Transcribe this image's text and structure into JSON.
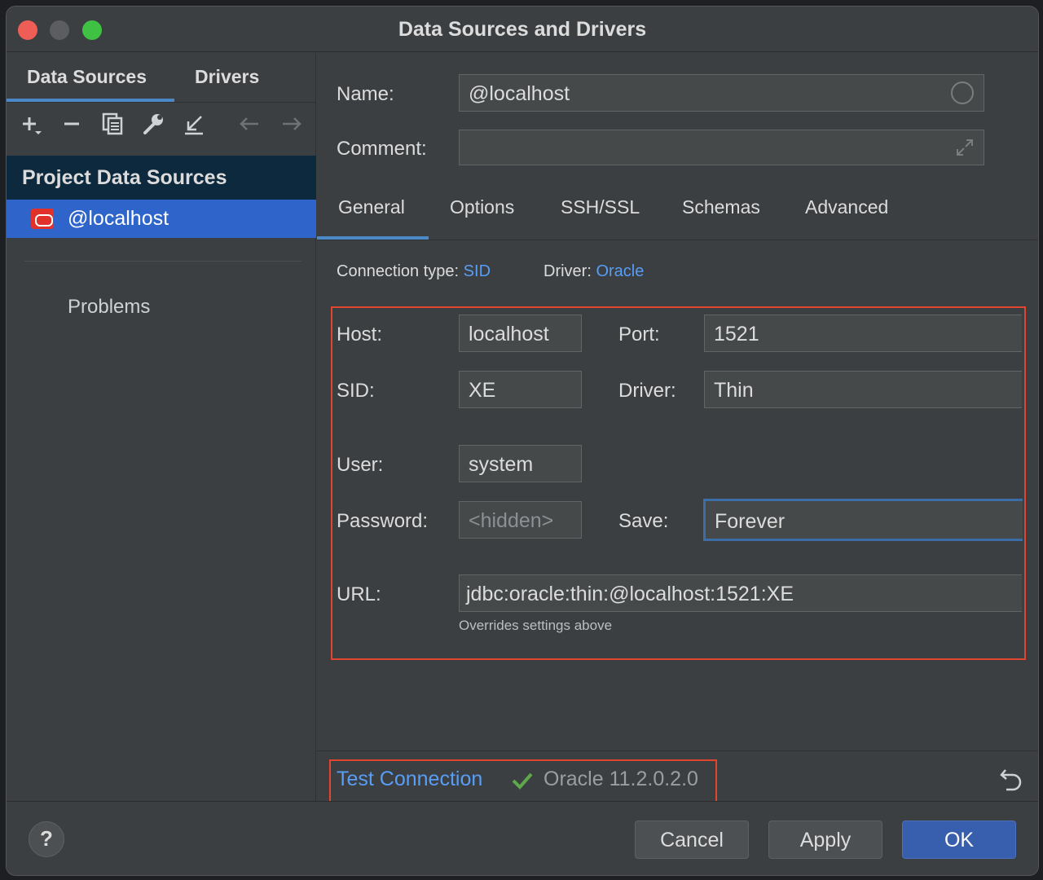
{
  "window": {
    "title": "Data Sources and Drivers"
  },
  "left": {
    "tabs": [
      {
        "label": "Data Sources"
      },
      {
        "label": "Drivers"
      }
    ],
    "section_header": "Project Data Sources",
    "items": [
      {
        "label": "@localhost",
        "icon": "oracle-db-icon"
      }
    ],
    "problems_label": "Problems"
  },
  "form": {
    "name_label": "Name:",
    "name_value": "@localhost",
    "comment_label": "Comment:",
    "comment_value": ""
  },
  "tabs": [
    {
      "label": "General"
    },
    {
      "label": "Options"
    },
    {
      "label": "SSH/SSL"
    },
    {
      "label": "Schemas"
    },
    {
      "label": "Advanced"
    }
  ],
  "connection": {
    "type_label": "Connection type:",
    "type_value": "SID",
    "driver_label": "Driver:",
    "driver_value": "Oracle"
  },
  "fields": {
    "host_label": "Host:",
    "host_value": "localhost",
    "port_label": "Port:",
    "port_value": "1521",
    "sid_label": "SID:",
    "sid_value": "XE",
    "driver_label": "Driver:",
    "driver_value": "Thin",
    "user_label": "User:",
    "user_value": "system",
    "password_label": "Password:",
    "password_placeholder": "<hidden>",
    "save_label": "Save:",
    "save_value": "Forever",
    "url_label": "URL:",
    "url_value": "jdbc:oracle:thin:@localhost:1521:XE",
    "url_hint": "Overrides settings above"
  },
  "test": {
    "link_label": "Test Connection",
    "result": "Oracle 11.2.0.2.0"
  },
  "footer": {
    "help_label": "?",
    "cancel_label": "Cancel",
    "apply_label": "Apply",
    "ok_label": "OK"
  },
  "colors": {
    "accent": "#589df6",
    "selection": "#2f65ca",
    "highlight_box": "#e0452f",
    "success": "#5fa74a"
  }
}
